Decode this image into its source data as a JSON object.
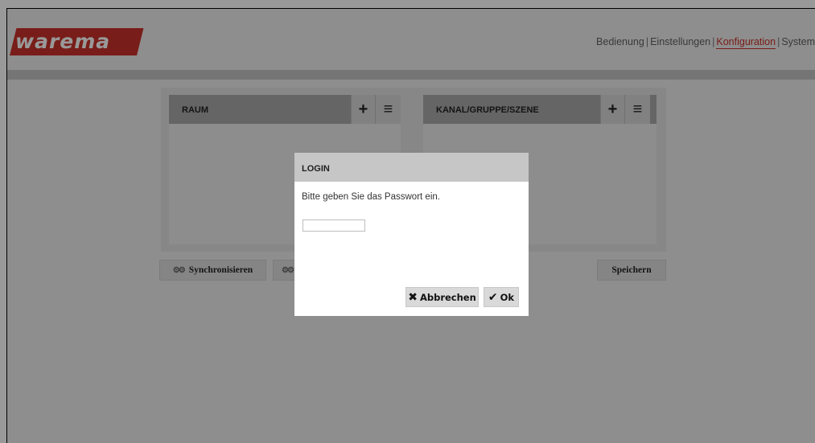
{
  "header": {
    "logo_text": "warema",
    "nav": [
      {
        "label": "Bedienung"
      },
      {
        "label": "Einstellungen"
      },
      {
        "label": "Konfiguration"
      },
      {
        "label": "System"
      }
    ],
    "separator": "|"
  },
  "panels": {
    "left": {
      "title": "RAUM",
      "add_icon": "+",
      "menu_icon": "≡"
    },
    "right": {
      "title": "KANAL/GRUPPE/SZENE",
      "add_icon": "+",
      "menu_icon": "≡"
    }
  },
  "actions": {
    "sync_label": "Synchronisieren",
    "save_label": "Speichern",
    "gear_icon": "⚙⚙"
  },
  "dialog": {
    "title": "LOGIN",
    "message": "Bitte geben Sie das Passwort ein.",
    "password_value": "",
    "cancel_label": "Abbrechen",
    "ok_label": "Ok",
    "cancel_icon": "✖",
    "ok_icon": "✔"
  },
  "colors": {
    "brand": "#c8312a",
    "overlay": "rgba(0,0,0,0.40)"
  }
}
